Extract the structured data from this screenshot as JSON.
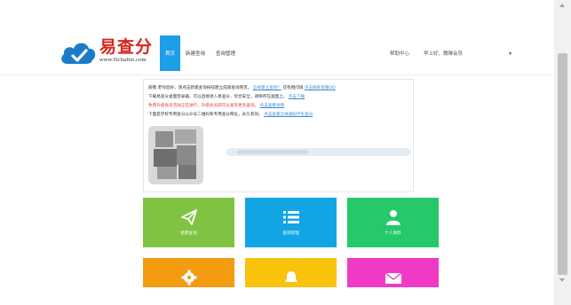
{
  "header": {
    "logo_title": "易查分",
    "logo_url": "www.Yichafen.com",
    "nav": [
      {
        "label": "首页",
        "active": true
      },
      {
        "label": "新建查询",
        "active": false
      },
      {
        "label": "查询管理",
        "active": false
      }
    ],
    "help": "帮助中心",
    "greeting": "早上好，魏琳会员",
    "dropdown": "▾"
  },
  "notice": {
    "line1_text": "部哦 老师您好，请点击新建查询按钮建立成绩查询网页。",
    "line1_link1": "怎样建立查询？",
    "line1_mid": "还有相问请",
    "line1_link2": "点击联系客服QQ",
    "line2_text": "下载易查分桌面登录器，可以直接进入易查分，综合安全，请保存在桌面上。",
    "line2_link": "点击下载",
    "line3_text": "免费升级会员活动正在进行，升级会员即可以发布更多查询，",
    "line3_link": "点击查看详情",
    "line4_text": "下面是学校专用查分公众号二维码和专用查分网址，永久有效。",
    "line4_link": "点击查看怎样通知学生查分"
  },
  "tiles": [
    {
      "label": "新建查询",
      "icon": "paper-plane-icon",
      "color": "#80c342"
    },
    {
      "label": "查询管理",
      "icon": "list-icon",
      "color": "#12a5e6"
    },
    {
      "label": "个人资料",
      "icon": "user-icon",
      "color": "#25c96a"
    },
    {
      "label": "",
      "icon": "gear-icon",
      "color": "#f39c12"
    },
    {
      "label": "",
      "icon": "bell-icon",
      "color": "#f8c30a"
    },
    {
      "label": "",
      "icon": "mail-icon",
      "color": "#f03ac5"
    }
  ]
}
